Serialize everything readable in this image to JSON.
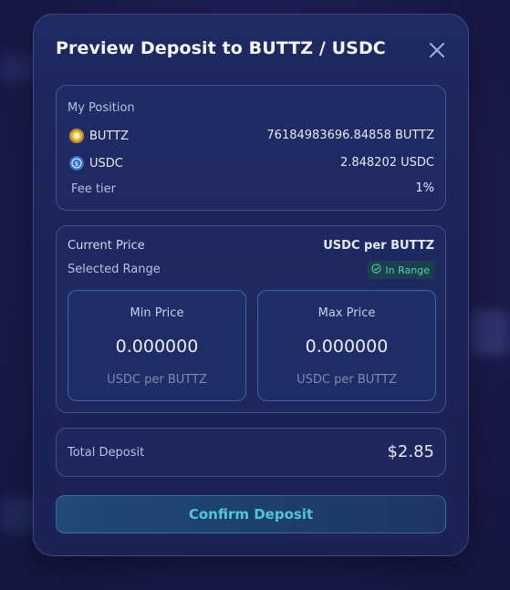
{
  "modal": {
    "title": "Preview Deposit to BUTTZ / USDC"
  },
  "position": {
    "header": "My Position",
    "tokens": [
      {
        "symbol": "BUTTZ",
        "amount": "76184983696.84858 BUTTZ",
        "icon": "buttz-token-icon",
        "color": "#e5b93a"
      },
      {
        "symbol": "USDC",
        "amount": "2.848202 USDC",
        "icon": "usdc-token-icon",
        "color": "#2f6fd1"
      }
    ],
    "fee_label": "Fee tier",
    "fee_value": "1%"
  },
  "price": {
    "current_label": "Current Price",
    "current_value": "USDC per BUTTZ",
    "range_label": "Selected Range",
    "range_status": "In Range",
    "min": {
      "label": "Min Price",
      "value": "0.000000",
      "unit": "USDC per BUTTZ"
    },
    "max": {
      "label": "Max Price",
      "value": "0.000000",
      "unit": "USDC per BUTTZ"
    }
  },
  "total": {
    "label": "Total Deposit",
    "value": "$2.85"
  },
  "confirm_label": "Confirm Deposit",
  "colors": {
    "accent": "#4fc7d9",
    "in_range": "#4fd1a1",
    "modal_bg": "#1e2a63"
  }
}
